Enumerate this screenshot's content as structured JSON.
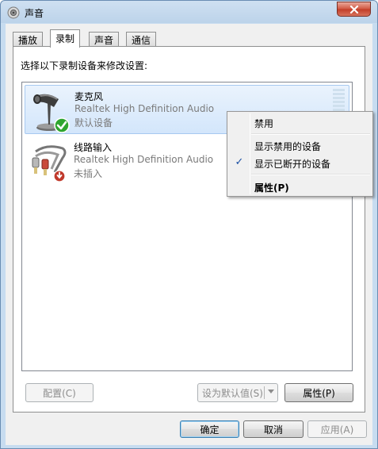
{
  "window": {
    "title": "声音"
  },
  "tabs": [
    {
      "label": "播放"
    },
    {
      "label": "录制"
    },
    {
      "label": "声音"
    },
    {
      "label": "通信"
    }
  ],
  "panel": {
    "instruction": "选择以下录制设备来修改设置:",
    "devices": [
      {
        "name": "麦克风",
        "driver": "Realtek High Definition Audio",
        "status": "默认设备",
        "icon": "microphone-icon",
        "badge": "default-check-icon",
        "selected": true
      },
      {
        "name": "线路输入",
        "driver": "Realtek High Definition Audio",
        "status": "未插入",
        "icon": "line-in-jack-icon",
        "badge": "unplugged-icon",
        "selected": false
      }
    ]
  },
  "buttons": {
    "configure": "配置(C)",
    "set_default": "设为默认值(S)",
    "properties": "属性(P)",
    "ok": "确定",
    "cancel": "取消",
    "apply": "应用(A)"
  },
  "context_menu": {
    "items": [
      {
        "label": "禁用",
        "checked": false,
        "bold": false
      },
      {
        "label": "显示禁用的设备",
        "checked": false,
        "bold": false
      },
      {
        "label": "显示已断开的设备",
        "checked": true,
        "bold": false
      },
      {
        "label": "属性(P)",
        "checked": false,
        "bold": true
      }
    ]
  },
  "colors": {
    "selection": "#d3e6fb",
    "check_blue": "#1a4fa3",
    "default_badge_green": "#2fa52f",
    "unplugged_badge_red": "#c0392b"
  }
}
